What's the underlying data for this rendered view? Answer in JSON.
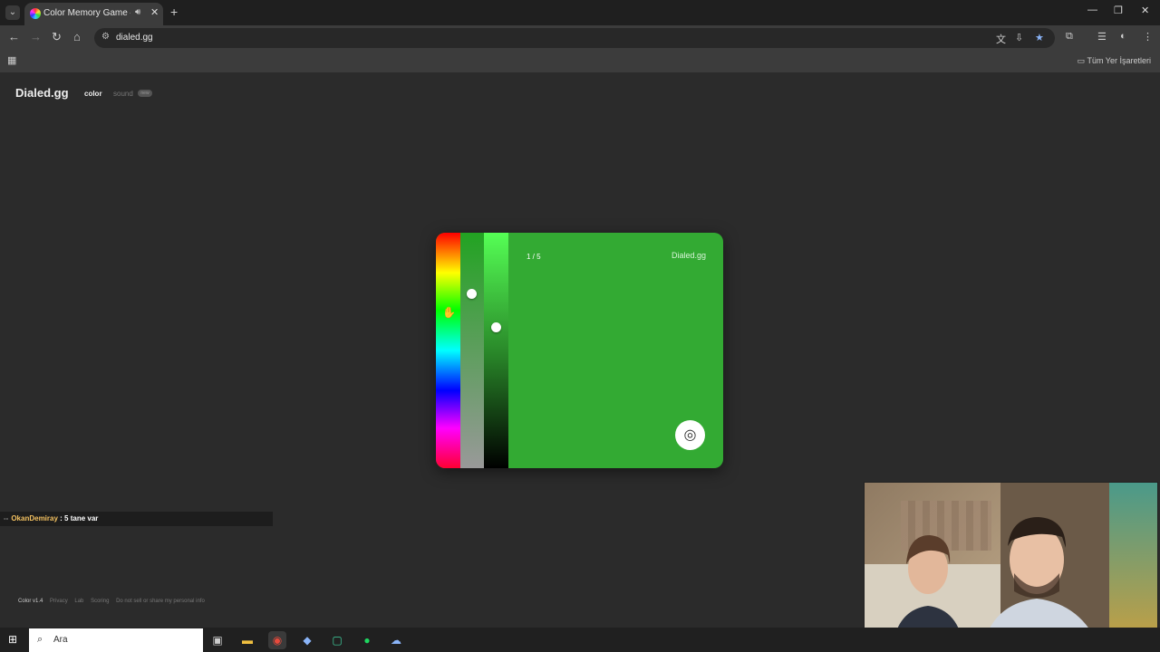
{
  "browser": {
    "tab_title": "Color Memory Game — Ho",
    "audio_icon": "speaker-icon",
    "url": "dialed.gg",
    "all_bookmarks_label": "Tüm Yer İşaretleri"
  },
  "site": {
    "logo": "Dialed.gg",
    "nav_color": "color",
    "nav_sound": "sound",
    "new_badge": "new"
  },
  "game": {
    "round": "1 / 5",
    "brand": "Dialed.gg",
    "current_color": "#33aa33",
    "submit_icon": "target-icon"
  },
  "chat": {
    "user": "OkanDemiray",
    "message": ": 5 tane var"
  },
  "footer": {
    "version": "Color v1.4",
    "links": [
      "Privacy",
      "Lab",
      "Scoring",
      "Do not sell or share my personal info"
    ]
  },
  "taskbar": {
    "search_placeholder": "Ara"
  }
}
